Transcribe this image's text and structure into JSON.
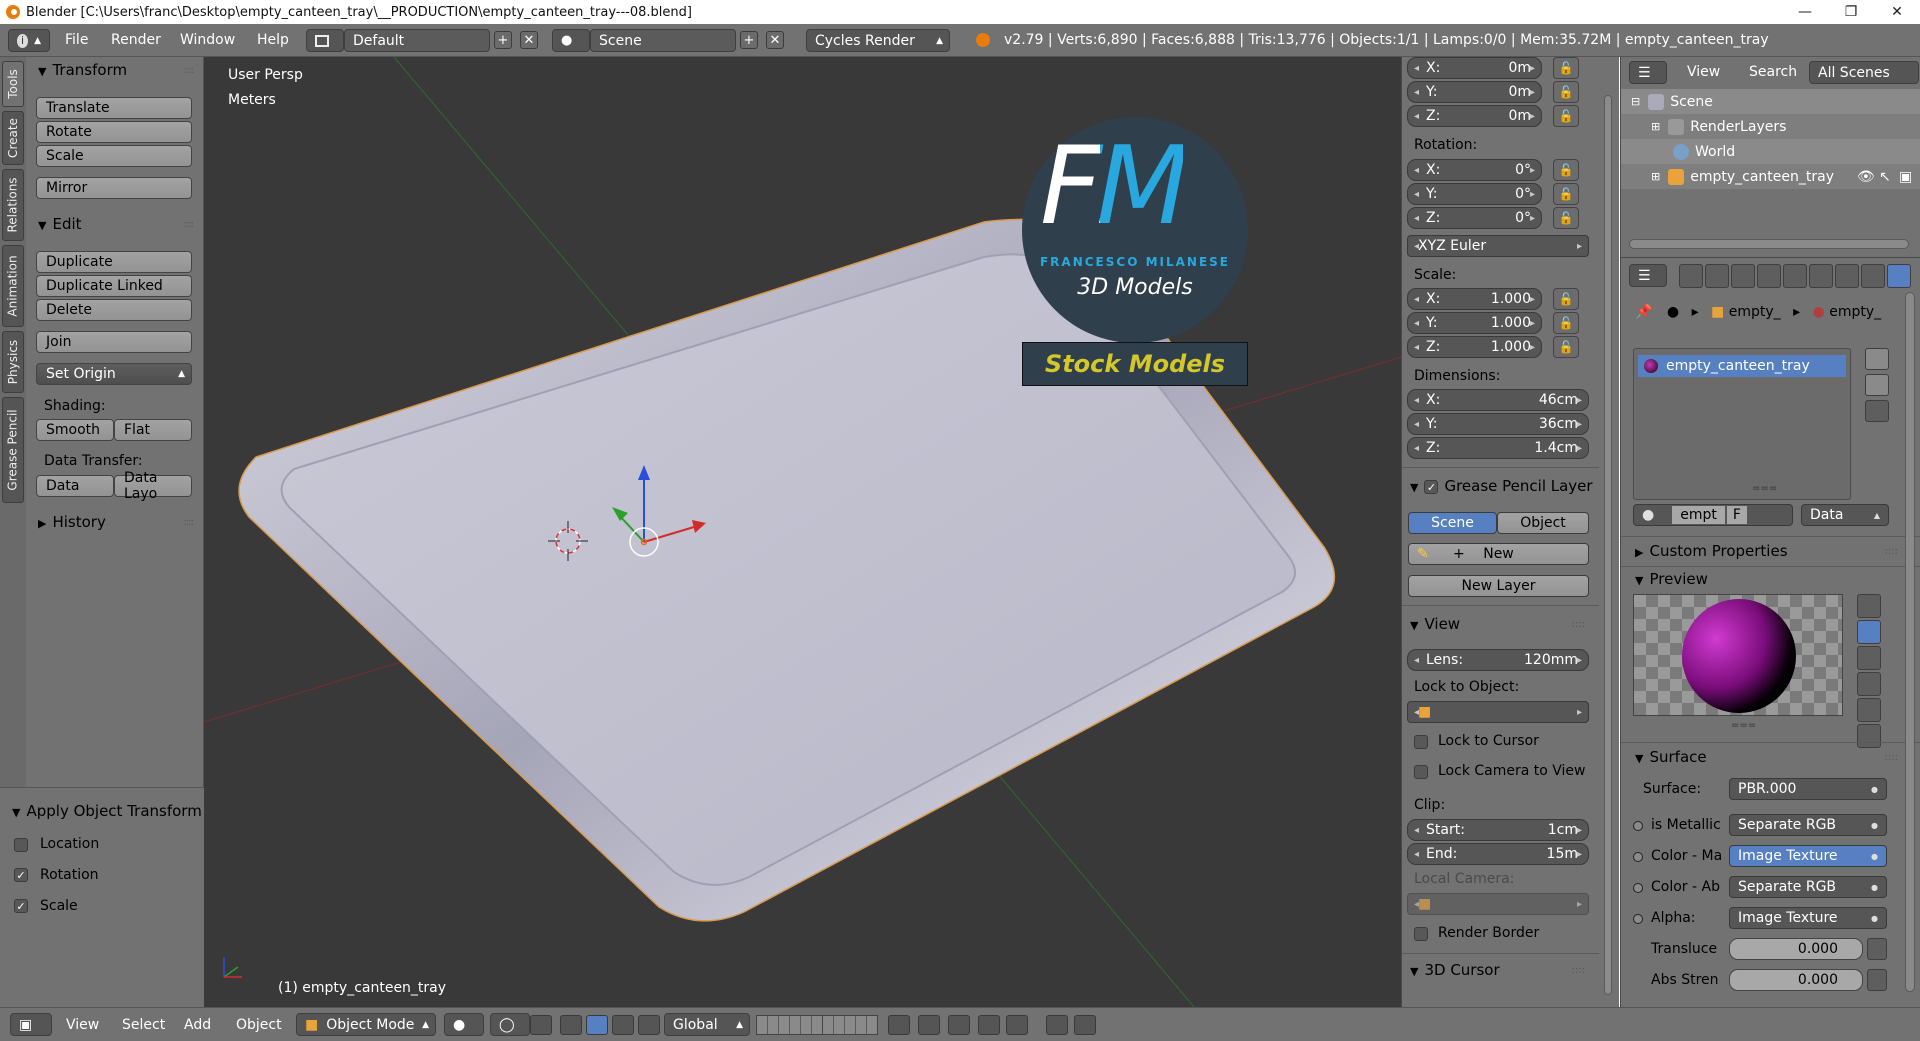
{
  "titlebar": {
    "title": "Blender [C:\\Users\\franc\\Desktop\\empty_canteen_tray\\__PRODUCTION\\empty_canteen_tray---08.blend]",
    "minimize": "—",
    "maximize": "❐",
    "close": "✕"
  },
  "info": {
    "menus": [
      "File",
      "Render",
      "Window",
      "Help"
    ],
    "layout": "Default",
    "scene": "Scene",
    "engine": "Cycles Render",
    "stats": "v2.79 | Verts:6,890 | Faces:6,888 | Tris:13,776 | Objects:1/1 | Lamps:0/0 | Mem:35.72M | empty_canteen_tray"
  },
  "tabs": [
    "Tools",
    "Create",
    "Relations",
    "Animation",
    "Physics",
    "Grease Pencil"
  ],
  "toolshelf": {
    "transform_title": "Transform",
    "translate": "Translate",
    "rotate": "Rotate",
    "scale": "Scale",
    "mirror": "Mirror",
    "edit_title": "Edit",
    "duplicate": "Duplicate",
    "duplicate_linked": "Duplicate Linked",
    "delete": "Delete",
    "join": "Join",
    "set_origin": "Set Origin",
    "shading_label": "Shading:",
    "smooth": "Smooth",
    "flat": "Flat",
    "data_transfer_label": "Data Transfer:",
    "data": "Data",
    "data_layout": "Data Layo",
    "history_title": "History",
    "apply_title": "Apply Object Transform",
    "location": "Location",
    "rotation": "Rotation",
    "scale_opt": "Scale"
  },
  "viewport": {
    "view_name": "User Persp",
    "units": "Meters",
    "object_label": "(1) empty_canteen_tray",
    "watermark_fm": "FM",
    "watermark_name": "FRANCESCO MILANESE",
    "watermark_sub": "3D Models",
    "watermark_stock": "Stock Models"
  },
  "npanel": {
    "location": [
      {
        "k": "X:",
        "v": "0m"
      },
      {
        "k": "Y:",
        "v": "0m"
      },
      {
        "k": "Z:",
        "v": "0m"
      }
    ],
    "rotation_label": "Rotation:",
    "rotation": [
      {
        "k": "X:",
        "v": "0°"
      },
      {
        "k": "Y:",
        "v": "0°"
      },
      {
        "k": "Z:",
        "v": "0°"
      }
    ],
    "rotation_mode": "XYZ Euler",
    "scale_label": "Scale:",
    "scale": [
      {
        "k": "X:",
        "v": "1.000"
      },
      {
        "k": "Y:",
        "v": "1.000"
      },
      {
        "k": "Z:",
        "v": "1.000"
      }
    ],
    "dimensions_label": "Dimensions:",
    "dimensions": [
      {
        "k": "X:",
        "v": "46cm"
      },
      {
        "k": "Y:",
        "v": "36cm"
      },
      {
        "k": "Z:",
        "v": "1.4cm"
      }
    ],
    "gp_title": "Grease Pencil Layer",
    "gp_scene": "Scene",
    "gp_object": "Object",
    "gp_new": "New",
    "gp_new_layer": "New Layer",
    "view_title": "View",
    "lens_k": "Lens:",
    "lens_v": "120mm",
    "lock_object_label": "Lock to Object:",
    "lock_cursor": "Lock to Cursor",
    "lock_camera": "Lock Camera to View",
    "clip_label": "Clip:",
    "clip_start_k": "Start:",
    "clip_start_v": "1cm",
    "clip_end_k": "End:",
    "clip_end_v": "15m",
    "local_camera_label": "Local Camera:",
    "render_border": "Render Border",
    "cursor_title": "3D Cursor"
  },
  "outliner": {
    "view": "View",
    "search": "Search",
    "filter": "All Scenes",
    "scene": "Scene",
    "render_layers": "RenderLayers",
    "world": "World",
    "object": "empty_canteen_tray"
  },
  "properties": {
    "crumb1": "empty_",
    "crumb2": "empty_",
    "material_slot": "empty_canteen_tray",
    "mat_name": "empt",
    "mat_f": "F",
    "link": "Data",
    "custom_props": "Custom Properties",
    "preview": "Preview",
    "surface_title": "Surface",
    "surface_label": "Surface:",
    "surface_value": "PBR.000",
    "rows": [
      {
        "label": "is Metallic",
        "value": "Separate RGB",
        "blue": false
      },
      {
        "label": "Color - Ma",
        "value": "Image Texture",
        "blue": true
      },
      {
        "label": "Color - Ab",
        "value": "Separate RGB",
        "blue": false
      },
      {
        "label": "Alpha:",
        "value": "Image Texture",
        "blue": false
      }
    ],
    "translucency_label": "Transluce",
    "translucency_value": "0.000",
    "abs_label": "Abs Stren",
    "abs_value": "0.000"
  },
  "bottombar": {
    "view": "View",
    "select": "Select",
    "add": "Add",
    "object": "Object",
    "mode": "Object Mode",
    "orientation": "Global"
  }
}
